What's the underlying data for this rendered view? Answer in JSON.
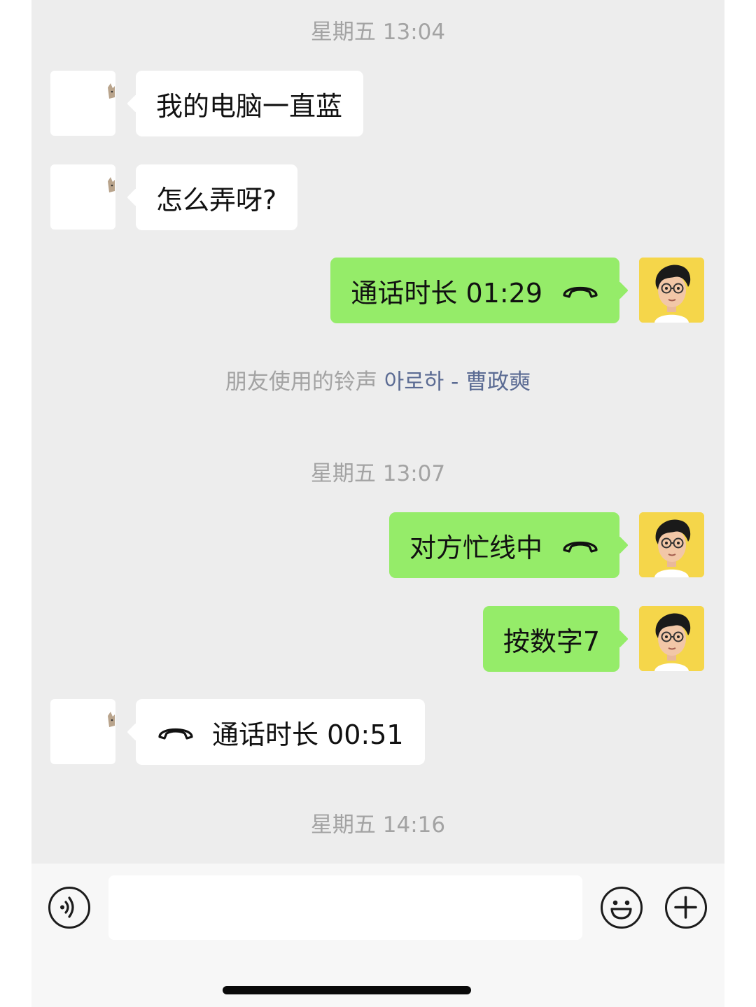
{
  "chat": {
    "timestamps": [
      "星期五 13:04",
      "星期五 13:07",
      "星期五 14:16"
    ],
    "messages": [
      {
        "from": "friend",
        "text": "我的电脑一直蓝"
      },
      {
        "from": "friend",
        "text": "怎么弄呀?"
      },
      {
        "from": "me",
        "text": "通话时长 01:29",
        "icon": "phone-hangup-icon"
      },
      {
        "from": "me",
        "text": "对方忙线中",
        "icon": "phone-hangup-icon"
      },
      {
        "from": "me",
        "text": "按数字7"
      },
      {
        "from": "friend",
        "text": "通话时长 00:51",
        "icon": "phone-hangup-icon"
      }
    ],
    "ringtone": {
      "prefix": "朋友使用的铃声",
      "song": "아로하 - 曹政奭"
    }
  },
  "input_bar": {
    "voice_icon": "voice-input-icon",
    "emoji_icon": "emoji-icon",
    "plus_icon": "plus-icon",
    "text_value": ""
  },
  "colors": {
    "background": "#ededed",
    "outgoing_bubble": "#95ec69",
    "incoming_bubble": "#ffffff",
    "timestamp": "#a3a3a3",
    "ringtone_link": "#5b6b93"
  }
}
